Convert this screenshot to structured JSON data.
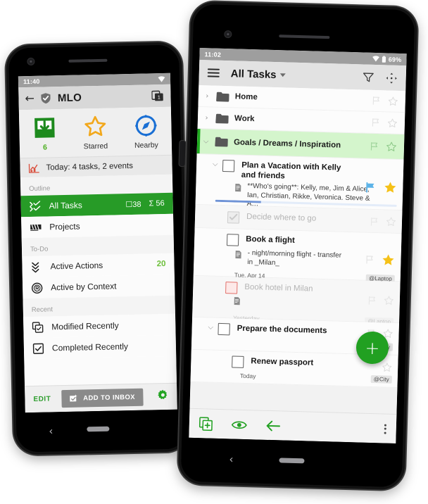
{
  "left_phone": {
    "status": {
      "time": "11:40",
      "wifi_icon": "wifi-icon"
    },
    "appbar": {
      "back_icon": "back-arrow-icon",
      "app_icon": "shield-check-icon",
      "title": "MLO",
      "tab_count": "1"
    },
    "quick_actions": [
      {
        "icon": "inbox-download-icon",
        "label": "6",
        "accent": "#4caf20"
      },
      {
        "icon": "star-outline-icon",
        "label": "Starred",
        "accent": "#f3a81c"
      },
      {
        "icon": "compass-icon",
        "label": "Nearby",
        "accent": "#1a6fd4"
      }
    ],
    "today": {
      "icon": "chart-icon",
      "text": "Today: 4 tasks, 2 events"
    },
    "sections": [
      {
        "header": "Outline",
        "items": [
          {
            "icon": "all-tasks-icon",
            "label": "All Tasks",
            "active": true,
            "badge_box": "38",
            "badge_sum": "56",
            "box_symbol": "☐",
            "sum_symbol": "Σ"
          },
          {
            "icon": "projects-icon",
            "label": "Projects",
            "active": false
          }
        ]
      },
      {
        "header": "To-Do",
        "items": [
          {
            "icon": "active-actions-icon",
            "label": "Active Actions",
            "active": false,
            "count": "20"
          },
          {
            "icon": "context-icon",
            "label": "Active by Context",
            "active": false
          }
        ]
      },
      {
        "header": "Recent",
        "items": [
          {
            "icon": "modified-recently-icon",
            "label": "Modified Recently",
            "active": false
          },
          {
            "icon": "completed-recently-icon",
            "label": "Completed Recently",
            "active": false
          }
        ]
      }
    ],
    "bottombar": {
      "edit_label": "EDIT",
      "inbox_label": "ADD TO INBOX",
      "inbox_icon": "add-to-inbox-icon",
      "settings_icon": "gear-icon"
    },
    "navbar": {
      "back_icon": "system-back-icon",
      "home_pill": "home-pill"
    }
  },
  "right_phone": {
    "status": {
      "time": "11:02",
      "wifi_icon": "wifi-icon",
      "battery_icon": "battery-icon",
      "battery": "69%"
    },
    "appbar": {
      "menu_icon": "hamburger-menu-icon",
      "title": "All Tasks",
      "caret_icon": "chevron-down-icon",
      "filter_icon": "filter-icon",
      "move-icon": "move-arrows-icon"
    },
    "rows": [
      {
        "kind": "folder",
        "twisty": "›",
        "label": "Home",
        "selected": false,
        "flag_icon": "flag-icon",
        "star_icon": "star-icon"
      },
      {
        "kind": "folder",
        "twisty": "›",
        "label": "Work",
        "selected": false,
        "flag_icon": "flag-icon",
        "star_icon": "star-icon"
      },
      {
        "kind": "folder",
        "twisty": "⌵",
        "label": "Goals / Dreams / Inspiration",
        "selected": true,
        "flag_icon": "flag-icon",
        "star_icon": "star-icon"
      },
      {
        "kind": "task",
        "twisty": "⌵",
        "indent": 1,
        "title": "Plan a Vacation with Kelly and friends",
        "note_icon": "note-icon",
        "note": "**Who's going**: Kelly, me, Jim & Alice, Ian, Christian, Rikke, Veronica. Steve & A…",
        "checkbox": "unchecked",
        "flag_icon": "flag-filled-icon",
        "flag_color": "#5cb3e8",
        "star_icon": "star-filled-icon",
        "star_color": "#f5c118",
        "progress_percent": 25
      },
      {
        "kind": "task",
        "indent": 2,
        "title": "Decide where to go",
        "checkbox": "checked-muted",
        "completed": true,
        "flag_icon": "flag-icon",
        "star_icon": "star-icon"
      },
      {
        "kind": "task",
        "indent": 2,
        "title": "Book a flight",
        "checkbox": "unchecked",
        "note_icon": "note-icon",
        "note": "- night/morning flight - transfer in _Milan_",
        "date": "Tue, Apr 14",
        "context": "@Laptop",
        "flag_icon": "flag-icon",
        "star_icon": "star-filled-icon",
        "star_color": "#f5c118"
      },
      {
        "kind": "task",
        "indent": 2,
        "title": "Book hotel in Milan",
        "checkbox": "red",
        "completed": true,
        "note_icon": "note-icon",
        "date": "Yesterday",
        "context": "@Laptop",
        "flag_icon": "flag-icon",
        "star_icon": "star-icon"
      },
      {
        "kind": "task",
        "twisty": "⌵",
        "indent": 1,
        "title": "Prepare the documents",
        "checkbox": "unchecked",
        "context": "@City",
        "flag_icon": "flag-icon",
        "star_icon": "star-icon"
      },
      {
        "kind": "task",
        "indent": 2,
        "title": "Renew passport",
        "checkbox": "unchecked",
        "date": "Today",
        "context": "@City",
        "star_icon": "star-icon"
      }
    ],
    "fab": {
      "icon": "plus-icon",
      "label": "+",
      "color": "#21a021"
    },
    "bottombar": {
      "add_icon": "add-task-icon",
      "view_icon": "eye-icon",
      "back_icon": "back-arrow-icon",
      "overflow_icon": "overflow-menu-icon"
    },
    "navbar": {
      "back_icon": "system-back-icon",
      "home_pill": "home-pill"
    }
  }
}
